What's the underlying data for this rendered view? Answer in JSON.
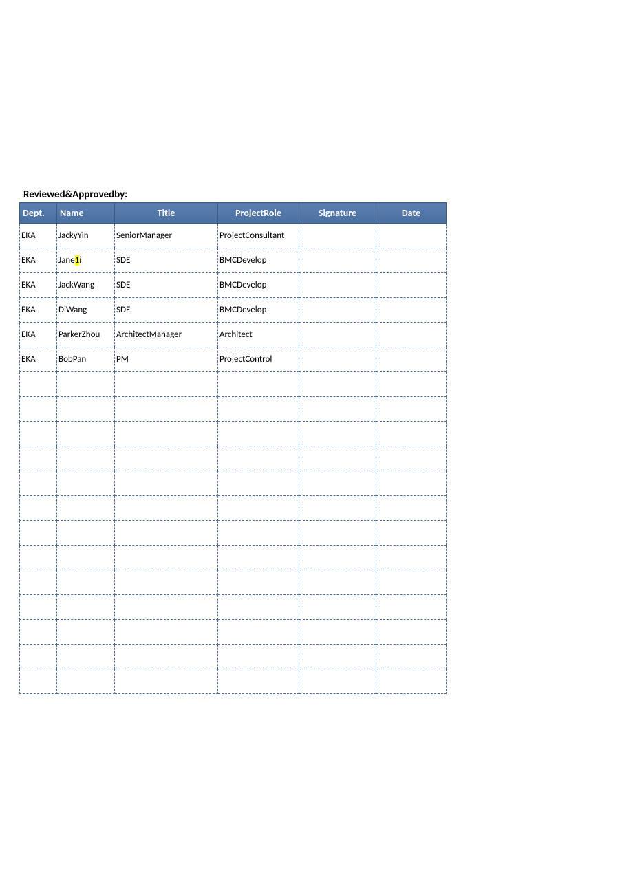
{
  "heading": "Reviewed&Approvedby:",
  "columns": {
    "dept": "Dept.",
    "name": "Name",
    "title": "Title",
    "role": "ProjectRole",
    "signature": "Signature",
    "date": "Date"
  },
  "rows": [
    {
      "dept": "EKA",
      "name_pre": "JackyYin",
      "name_hl": "",
      "name_post": "",
      "title": "SeniorManager",
      "role": "ProjectConsultant",
      "signature": "",
      "date": ""
    },
    {
      "dept": "EKA",
      "name_pre": "Jane",
      "name_hl": "1",
      "name_post": "i",
      "title": "SDE",
      "role": "BMCDevelop",
      "signature": "",
      "date": ""
    },
    {
      "dept": "EKA",
      "name_pre": "JackWang",
      "name_hl": "",
      "name_post": "",
      "title": "SDE",
      "role": "BMCDevelop",
      "signature": "",
      "date": ""
    },
    {
      "dept": "EKA",
      "name_pre": "DiWang",
      "name_hl": "",
      "name_post": "",
      "title": "SDE",
      "role": "BMCDevelop",
      "signature": "",
      "date": ""
    },
    {
      "dept": "EKA",
      "name_pre": "ParkerZhou",
      "name_hl": "",
      "name_post": "",
      "title": "ArchitectManager",
      "role": "Architect",
      "signature": "",
      "date": ""
    },
    {
      "dept": "EKA",
      "name_pre": "BobPan",
      "name_hl": "",
      "name_post": "",
      "title": "PM",
      "role": "ProjectControl",
      "signature": "",
      "date": ""
    },
    {
      "dept": "",
      "name_pre": "",
      "name_hl": "",
      "name_post": "",
      "title": "",
      "role": "",
      "signature": "",
      "date": ""
    },
    {
      "dept": "",
      "name_pre": "",
      "name_hl": "",
      "name_post": "",
      "title": "",
      "role": "",
      "signature": "",
      "date": ""
    },
    {
      "dept": "",
      "name_pre": "",
      "name_hl": "",
      "name_post": "",
      "title": "",
      "role": "",
      "signature": "",
      "date": ""
    },
    {
      "dept": "",
      "name_pre": "",
      "name_hl": "",
      "name_post": "",
      "title": "",
      "role": "",
      "signature": "",
      "date": ""
    },
    {
      "dept": "",
      "name_pre": "",
      "name_hl": "",
      "name_post": "",
      "title": "",
      "role": "",
      "signature": "",
      "date": ""
    },
    {
      "dept": "",
      "name_pre": "",
      "name_hl": "",
      "name_post": "",
      "title": "",
      "role": "",
      "signature": "",
      "date": ""
    },
    {
      "dept": "",
      "name_pre": "",
      "name_hl": "",
      "name_post": "",
      "title": "",
      "role": "",
      "signature": "",
      "date": ""
    },
    {
      "dept": "",
      "name_pre": "",
      "name_hl": "",
      "name_post": "",
      "title": "",
      "role": "",
      "signature": "",
      "date": ""
    },
    {
      "dept": "",
      "name_pre": "",
      "name_hl": "",
      "name_post": "",
      "title": "",
      "role": "",
      "signature": "",
      "date": ""
    },
    {
      "dept": "",
      "name_pre": "",
      "name_hl": "",
      "name_post": "",
      "title": "",
      "role": "",
      "signature": "",
      "date": ""
    },
    {
      "dept": "",
      "name_pre": "",
      "name_hl": "",
      "name_post": "",
      "title": "",
      "role": "",
      "signature": "",
      "date": ""
    },
    {
      "dept": "",
      "name_pre": "",
      "name_hl": "",
      "name_post": "",
      "title": "",
      "role": "",
      "signature": "",
      "date": ""
    },
    {
      "dept": "",
      "name_pre": "",
      "name_hl": "",
      "name_post": "",
      "title": "",
      "role": "",
      "signature": "",
      "date": ""
    }
  ]
}
